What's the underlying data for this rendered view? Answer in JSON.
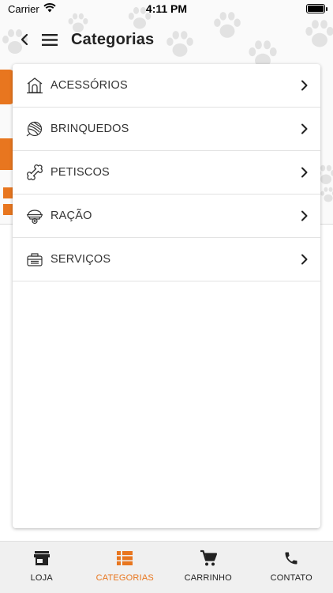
{
  "status_bar": {
    "carrier": "Carrier",
    "time": "4:11 PM"
  },
  "header": {
    "title": "Categorias",
    "back_icon": "chevron-left-icon",
    "menu_icon": "hamburger-menu-icon"
  },
  "categories": [
    {
      "label": "ACESSÓRIOS",
      "icon": "doghouse-icon"
    },
    {
      "label": "BRINQUEDOS",
      "icon": "yarn-ball-icon"
    },
    {
      "label": "PETISCOS",
      "icon": "bone-icon"
    },
    {
      "label": "RAÇÃO",
      "icon": "pet-food-bowl-icon"
    },
    {
      "label": "SERVIÇOS",
      "icon": "pet-carrier-icon"
    }
  ],
  "bottom_nav": [
    {
      "label": "LOJA",
      "icon": "store-icon",
      "active": false
    },
    {
      "label": "CATEGORIAS",
      "icon": "list-icon",
      "active": true
    },
    {
      "label": "CARRINHO",
      "icon": "cart-icon",
      "active": false
    },
    {
      "label": "CONTATO",
      "icon": "phone-icon",
      "active": false
    }
  ],
  "colors": {
    "accent": "#e8761f",
    "nav_background": "#f0f0f0",
    "paw": "#e2e2e2"
  }
}
